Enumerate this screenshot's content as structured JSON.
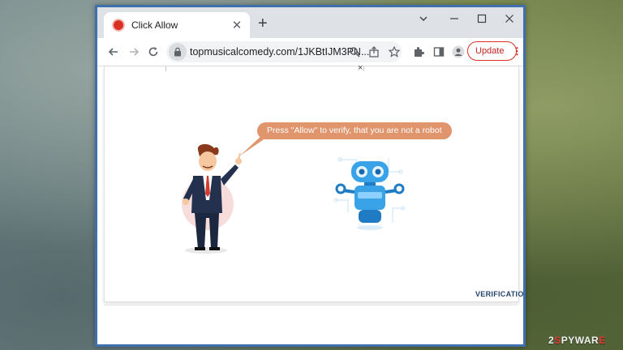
{
  "browser": {
    "tab_title": "Click Allow",
    "new_tab_symbol": "+",
    "tab_close_symbol": "✕",
    "url": "topmusicalcomedy.com/1JKBtIJM3PN...",
    "update_label": "Update",
    "window_controls": [
      "minimize-icon",
      "maximize-icon",
      "close-icon"
    ]
  },
  "page": {
    "close_symbol": "×",
    "bubble_text": "Press \"Allow\" to verify, that you are not a robot",
    "verification_label": "VERIFICATION"
  },
  "watermark": {
    "prefix": "2",
    "red": "S",
    "text": "PYWAR",
    "suffix": "E"
  },
  "colors": {
    "frame": "#3f6fad",
    "bubble": "#e0956d",
    "update_border": "#d93025",
    "robot": "#3aa3e8",
    "verification": "#22446b"
  }
}
